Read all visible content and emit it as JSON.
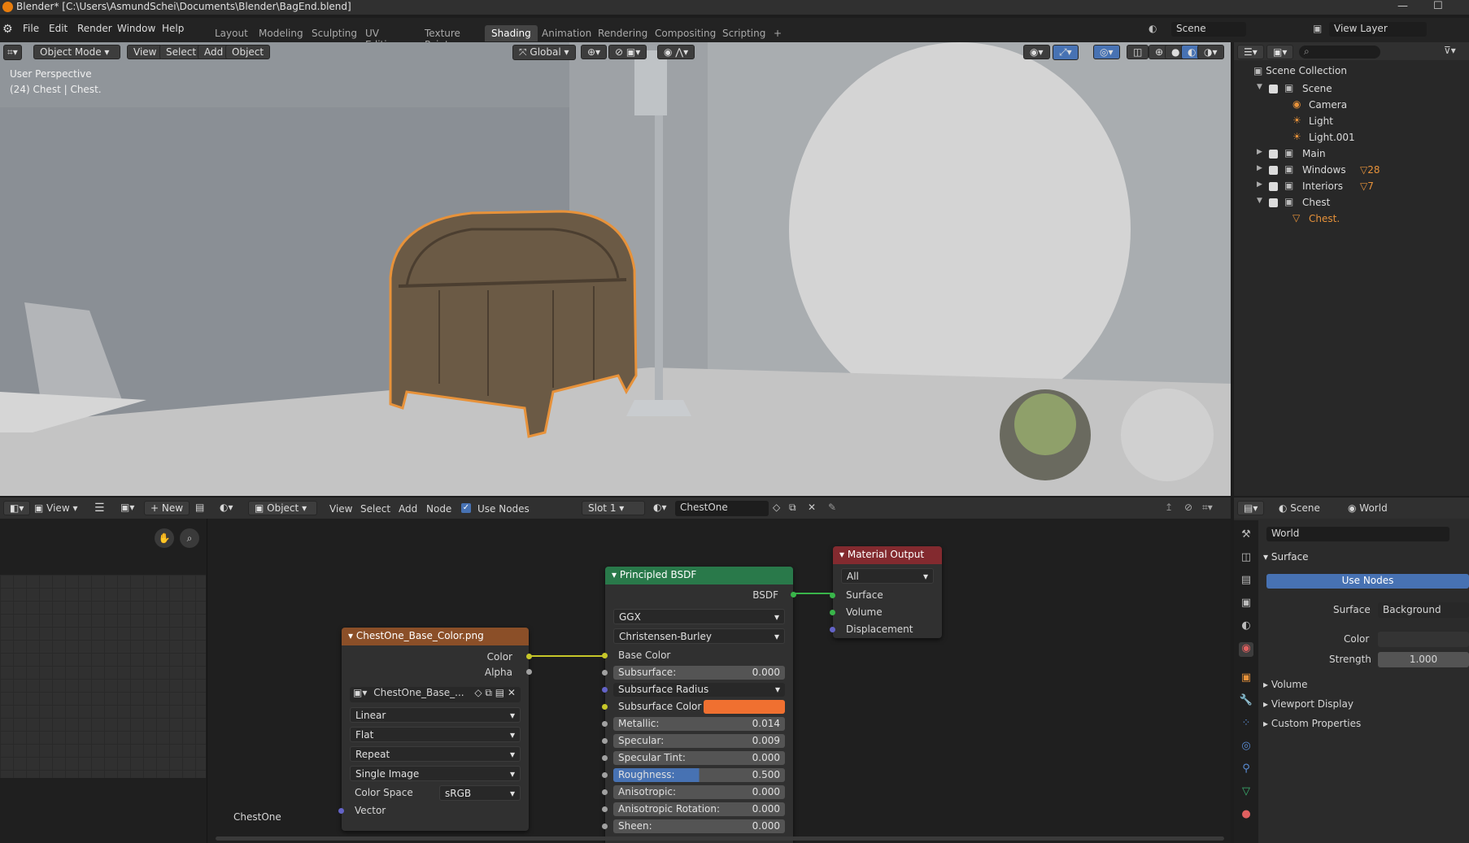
{
  "window": {
    "title": "Blender* [C:\\Users\\AsmundSchei\\Documents\\Blender\\BagEnd.blend]"
  },
  "menu": [
    "File",
    "Edit",
    "Render",
    "Window",
    "Help"
  ],
  "workspaces": [
    "Layout",
    "Modeling",
    "Sculpting",
    "UV Editing",
    "Texture Paint",
    "Shading",
    "Animation",
    "Rendering",
    "Compositing",
    "Scripting",
    "+"
  ],
  "active_workspace": "Shading",
  "scene": {
    "name": "Scene",
    "view_layer": "View Layer"
  },
  "viewport": {
    "mode": "Object Mode",
    "menus": [
      "View",
      "Select",
      "Add",
      "Object"
    ],
    "orientation": "Global",
    "overlay_text": [
      "User Perspective",
      "(24) Chest | Chest."
    ]
  },
  "outliner": {
    "root": "Scene Collection",
    "items": [
      {
        "name": "Scene",
        "icon": "collection-icon",
        "indent": 1,
        "expand": "▼"
      },
      {
        "name": "Camera",
        "icon": "camera-icon",
        "indent": 2,
        "expand": ""
      },
      {
        "name": "Light",
        "icon": "light-icon",
        "indent": 2,
        "expand": ""
      },
      {
        "name": "Light.001",
        "icon": "light-icon",
        "indent": 2,
        "expand": ""
      },
      {
        "name": "Main",
        "icon": "collection-icon",
        "indent": 1,
        "expand": "▶"
      },
      {
        "name": "Windows",
        "icon": "collection-icon",
        "indent": 1,
        "expand": "▶",
        "badge": "28"
      },
      {
        "name": "Interiors",
        "icon": "collection-icon",
        "indent": 1,
        "expand": "▶",
        "badge": "7"
      },
      {
        "name": "Chest",
        "icon": "collection-icon",
        "indent": 1,
        "expand": "▼"
      },
      {
        "name": "Chest.",
        "icon": "mesh-icon",
        "indent": 2,
        "expand": "",
        "selected": true
      }
    ]
  },
  "node_editor": {
    "header": {
      "view": "View",
      "object": "Object",
      "menus": [
        "View",
        "Select",
        "Add",
        "Node"
      ],
      "use_nodes": "Use Nodes",
      "slot": "Slot 1",
      "material": "ChestOne",
      "new": "New"
    },
    "label": "ChestOne",
    "image_node": {
      "title": "ChestOne_Base_Color.png",
      "out1": "Color",
      "out2": "Alpha",
      "image": "ChestOne_Base_...",
      "interp": "Linear",
      "proj": "Flat",
      "ext": "Repeat",
      "src": "Single Image",
      "cs_label": "Color Space",
      "cs": "sRGB",
      "vector": "Vector"
    },
    "bsdf": {
      "title": "Principled BSDF",
      "out": "BSDF",
      "dist": "GGX",
      "sss": "Christensen-Burley",
      "base": "Base Color",
      "fields": [
        {
          "label": "Subsurface:",
          "value": "0.000"
        },
        {
          "label": "Subsurface Radius",
          "value": ""
        },
        {
          "label": "Subsurface Color",
          "value": ""
        },
        {
          "label": "Metallic:",
          "value": "0.014"
        },
        {
          "label": "Specular:",
          "value": "0.009"
        },
        {
          "label": "Specular Tint:",
          "value": "0.000"
        },
        {
          "label": "Roughness:",
          "value": "0.500"
        },
        {
          "label": "Anisotropic:",
          "value": "0.000"
        },
        {
          "label": "Anisotropic Rotation:",
          "value": "0.000"
        },
        {
          "label": "Sheen:",
          "value": "0.000"
        }
      ]
    },
    "output": {
      "title": "Material Output",
      "target": "All",
      "in": [
        "Surface",
        "Volume",
        "Displacement"
      ]
    }
  },
  "properties": {
    "scene": "Scene",
    "world_tab": "World",
    "world": "World",
    "surface_hdr": "Surface",
    "use_nodes": "Use Nodes",
    "surface_label": "Surface",
    "surface": "Background",
    "color_label": "Color",
    "strength_label": "Strength",
    "strength": "1.000",
    "panels": [
      "Volume",
      "Viewport Display",
      "Custom Properties"
    ]
  },
  "colors": {
    "accent": "#4772b3",
    "select": "#e7923a",
    "header_shader": "#29794a",
    "header_output": "#832a2f",
    "header_texture": "#8b4f28",
    "subsurface": "#f07030"
  }
}
